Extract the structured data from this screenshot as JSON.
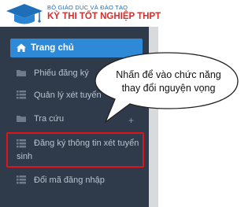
{
  "header": {
    "ministry": "BỘ GIÁO DỤC VÀ ĐÀO TẠO",
    "exam_title": "KỲ THI TỐT NGHIỆP THPT"
  },
  "menu": {
    "items": [
      {
        "label": "Trang chủ",
        "icon": "home-icon"
      },
      {
        "label": "Phiếu đăng ký",
        "icon": "folder-icon"
      },
      {
        "label": "Quản lý xét tuyển",
        "icon": "list-icon"
      },
      {
        "label": "Tra cứu",
        "icon": "folder-icon"
      },
      {
        "label_line1": "Đăng ký thông tin xét tuyển",
        "label_line2": "sinh",
        "icon": "list-icon"
      },
      {
        "label": "Đổi mã đăng nhập",
        "icon": "list-icon"
      }
    ],
    "expand_symbol": "+"
  },
  "callout": {
    "line1": "Nhấn để vào chức năng",
    "line2": "thay đổi nguyện vọng"
  },
  "colors": {
    "sidebar": "#2f3b4b",
    "active": "#2e8ad6",
    "highlight": "#e0131a",
    "title_red": "#d62d2d",
    "ministry_blue": "#1a6fb5"
  }
}
